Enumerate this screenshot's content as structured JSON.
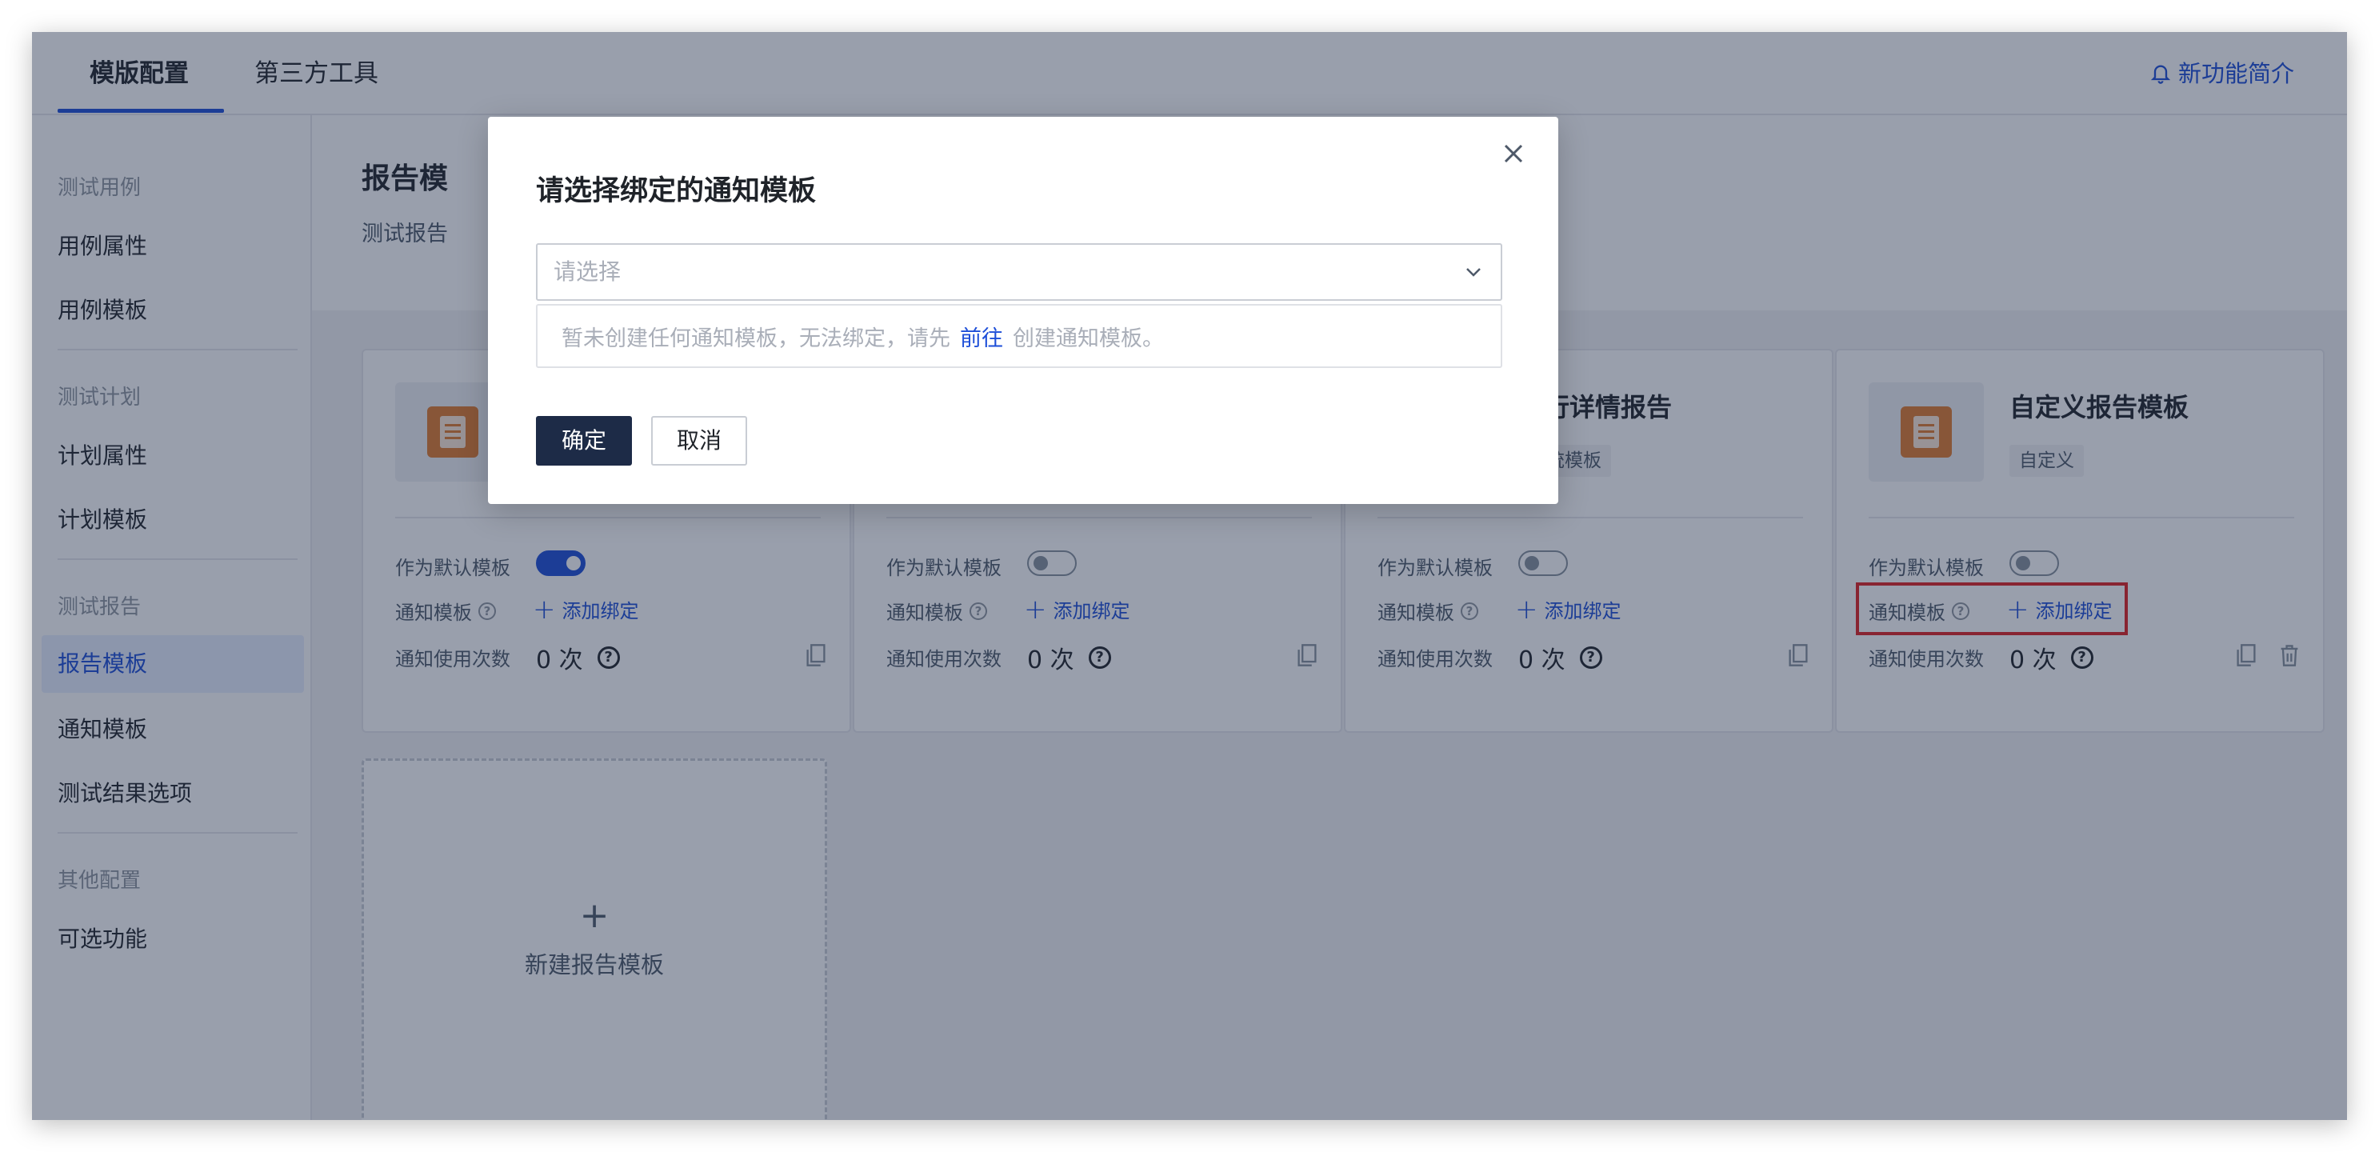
{
  "header": {
    "tabs": [
      {
        "label": "模版配置",
        "active": true
      },
      {
        "label": "第三方工具",
        "active": false
      }
    ],
    "whats_new": "新功能简介"
  },
  "sidebar": {
    "groups": [
      {
        "title": "测试用例",
        "items": [
          "用例属性",
          "用例模板"
        ]
      },
      {
        "title": "测试计划",
        "items": [
          "计划属性",
          "计划模板"
        ]
      },
      {
        "title": "测试报告",
        "items": [
          "报告模板",
          "通知模板",
          "测试结果选项"
        ]
      },
      {
        "title": "其他配置",
        "items": [
          "可选功能"
        ]
      }
    ],
    "active_item": "报告模板"
  },
  "main": {
    "title": "报告模",
    "subtitle": "测试报告",
    "cards": [
      {
        "title": "",
        "tag": "",
        "default_on": true
      },
      {
        "title": "",
        "tag": "",
        "default_on": false
      },
      {
        "title": "执行详情报告",
        "tag": "系统模板",
        "default_on": false
      },
      {
        "title": "自定义报告模板",
        "tag": "自定义",
        "default_on": false
      }
    ],
    "labels": {
      "default_template": "作为默认模板",
      "notify_template": "通知模板",
      "add_bind": "添加绑定",
      "notify_count": "通知使用次数",
      "count_value": "0 次"
    },
    "new_card": {
      "plus": "+",
      "label": "新建报告模板"
    }
  },
  "modal": {
    "title": "请选择绑定的通知模板",
    "select_placeholder": "请选择",
    "empty_before": "暂未创建任何通知模板，无法绑定，请先",
    "empty_link": "前往",
    "empty_after": "创建通知模板。",
    "confirm": "确定",
    "cancel": "取消"
  },
  "colors": {
    "accent": "#1d4ed8",
    "primary_button": "#1d2b47",
    "highlight": "#e02020",
    "doc_icon": "#e07a2c"
  }
}
